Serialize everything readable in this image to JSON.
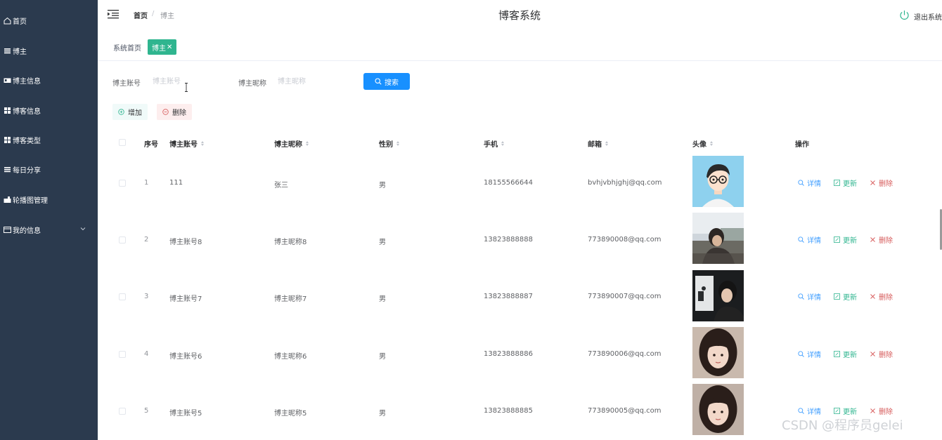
{
  "sidebar": {
    "items": [
      {
        "label": "首页",
        "icon": "home-icon"
      },
      {
        "label": "博主",
        "icon": "list-icon"
      },
      {
        "label": "博主信息",
        "icon": "id-card-icon"
      },
      {
        "label": "博客信息",
        "icon": "grid-icon"
      },
      {
        "label": "博客类型",
        "icon": "grid-icon"
      },
      {
        "label": "每日分享",
        "icon": "list-icon"
      },
      {
        "label": "轮播图管理",
        "icon": "image-icon"
      },
      {
        "label": "我的信息",
        "icon": "window-icon"
      }
    ]
  },
  "header": {
    "breadcrumb_home": "首页",
    "breadcrumb_sep": "/",
    "breadcrumb_current": "博主",
    "title": "博客系统",
    "logout_label": "退出系统"
  },
  "tabs": {
    "home": "系统首页",
    "active": "博主",
    "close_glyph": "✕"
  },
  "search": {
    "account_label": "博主账号",
    "account_placeholder": "博主账号",
    "nickname_label": "博主昵称",
    "nickname_placeholder": "博主昵称",
    "button_label": "搜索"
  },
  "actions": {
    "add_label": "增加",
    "delete_label": "删除"
  },
  "table": {
    "columns": [
      "序号",
      "博主账号",
      "博主昵称",
      "性别",
      "手机",
      "邮箱",
      "头像",
      "操作"
    ],
    "rows": [
      {
        "index": "1",
        "account": "111",
        "nickname": "张三",
        "gender": "男",
        "phone": "18155566644",
        "email": "bvhjvbhjghj@qq.com"
      },
      {
        "index": "2",
        "account": "博主账号8",
        "nickname": "博主昵称8",
        "gender": "男",
        "phone": "13823888888",
        "email": "773890008@qq.com"
      },
      {
        "index": "3",
        "account": "博主账号7",
        "nickname": "博主昵称7",
        "gender": "男",
        "phone": "13823888887",
        "email": "773890007@qq.com"
      },
      {
        "index": "4",
        "account": "博主账号6",
        "nickname": "博主昵称6",
        "gender": "男",
        "phone": "13823888886",
        "email": "773890006@qq.com"
      },
      {
        "index": "5",
        "account": "博主账号5",
        "nickname": "博主昵称5",
        "gender": "男",
        "phone": "13823888885",
        "email": "773890005@qq.com"
      }
    ],
    "op_detail": "详情",
    "op_update": "更新",
    "op_delete": "删除"
  },
  "watermark": "CSDN @程序员gelei",
  "colors": {
    "sidebar_bg": "#2b3a4e",
    "primary": "#1890ff",
    "tab_active": "#2fb58f",
    "danger": "#d65a5a"
  }
}
